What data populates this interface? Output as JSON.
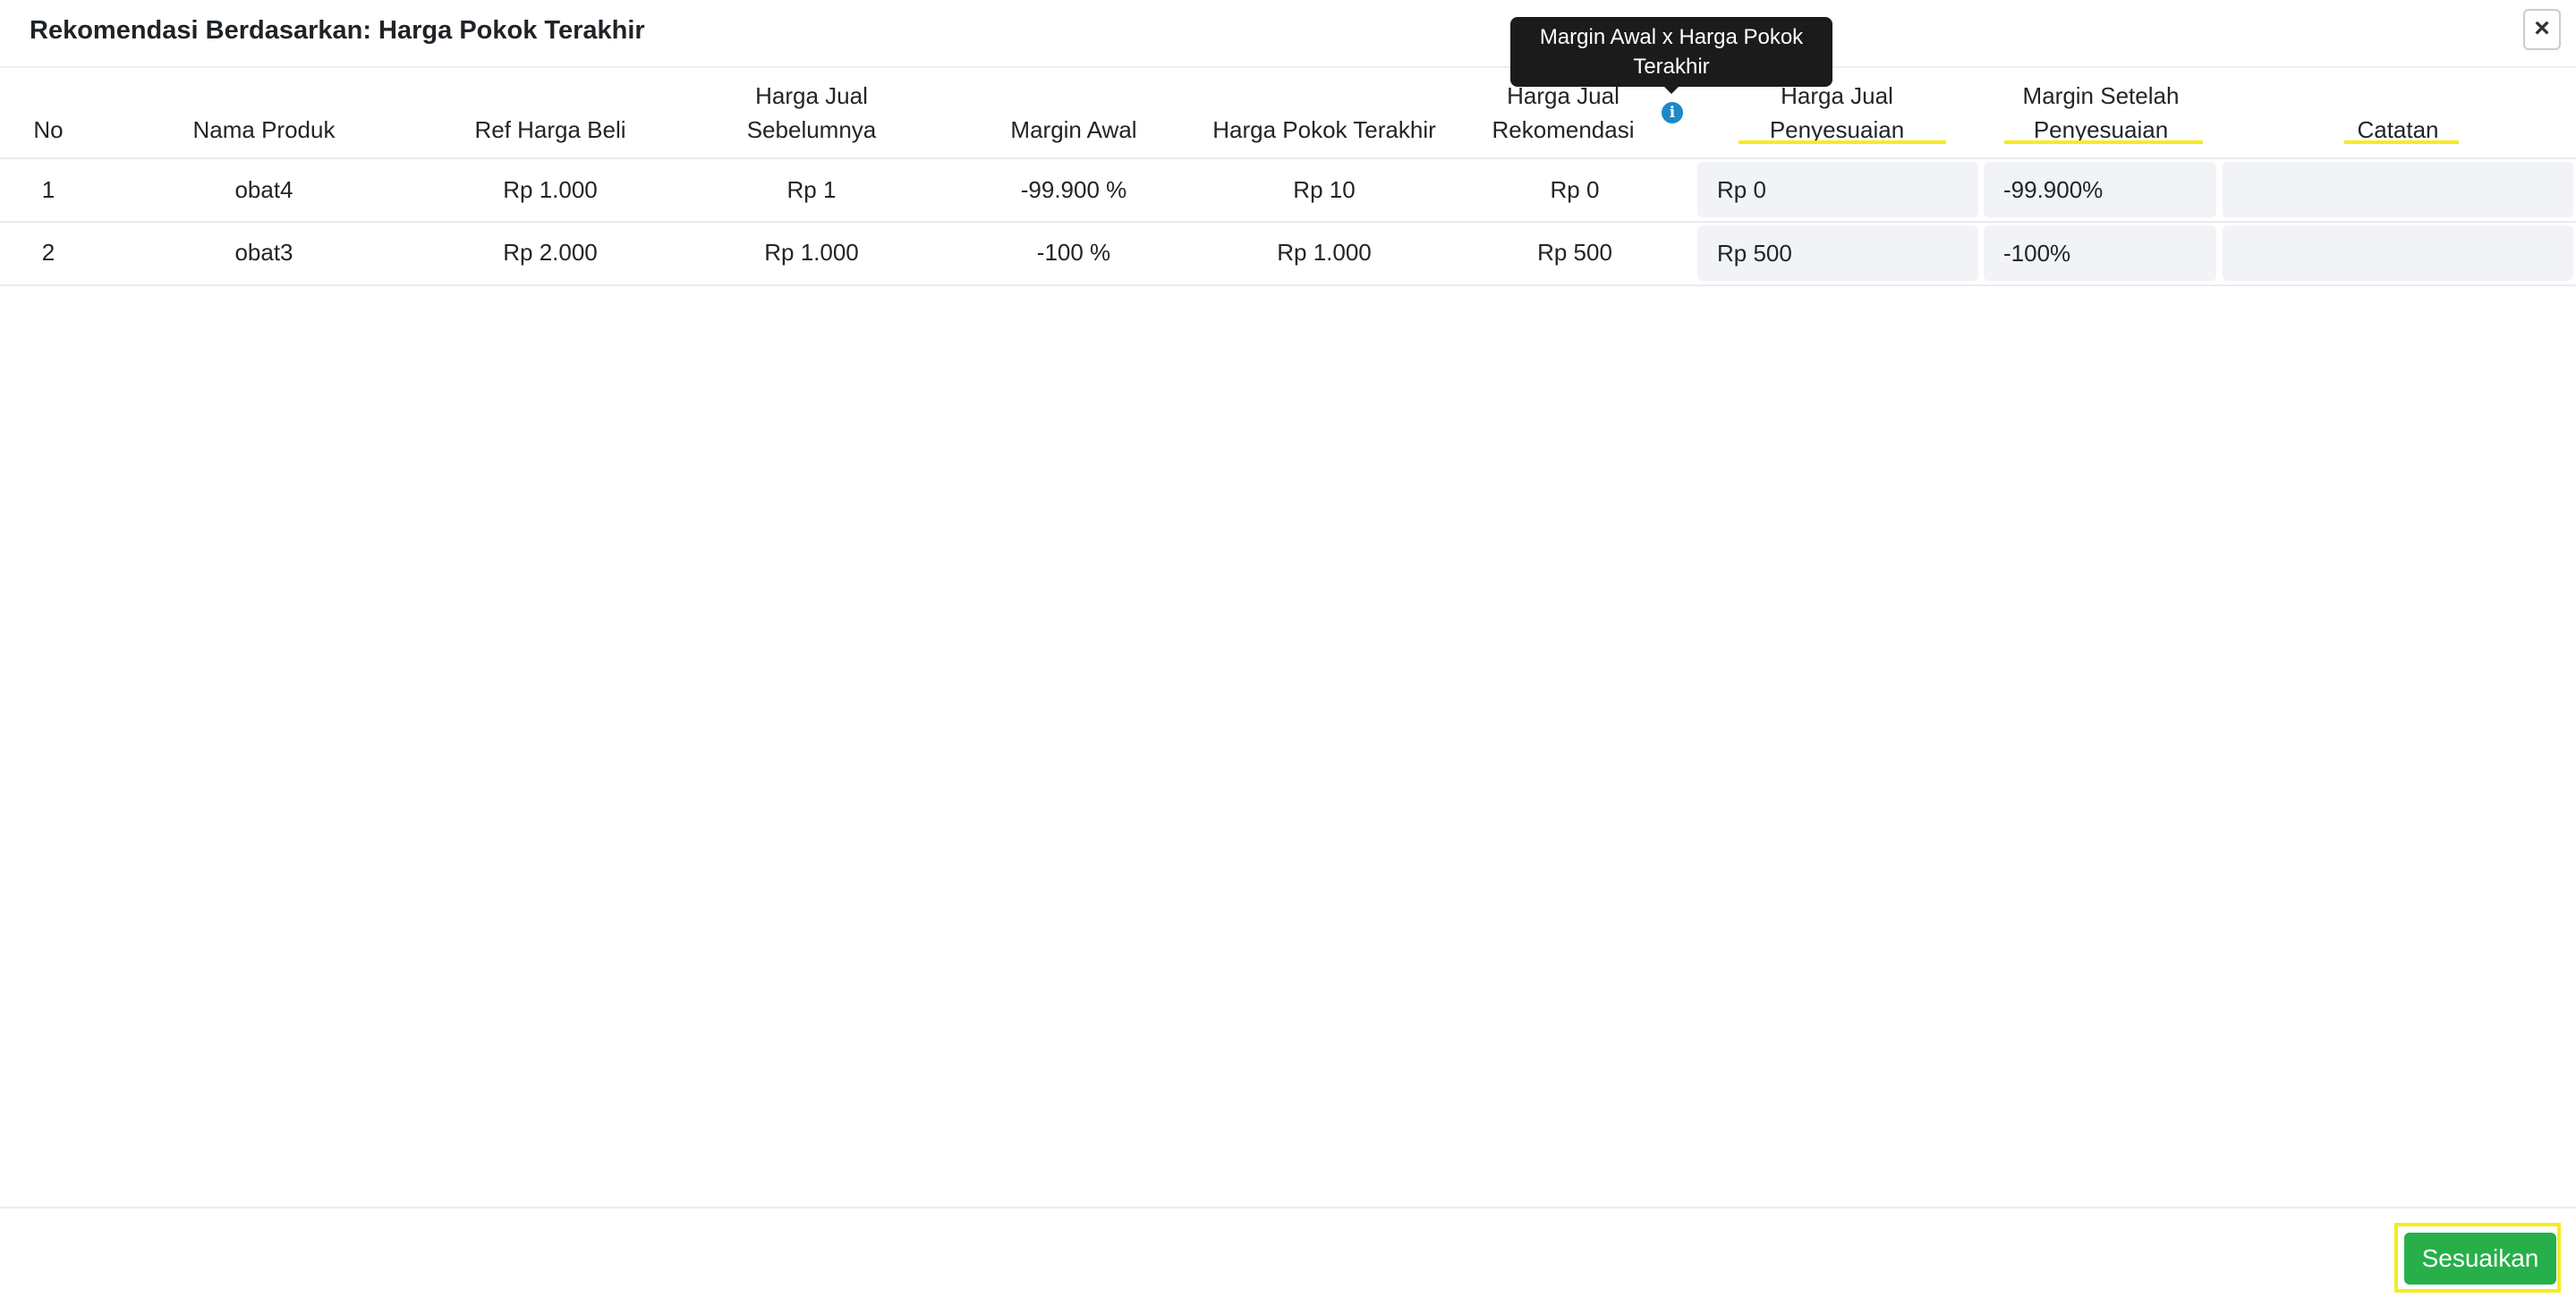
{
  "modal": {
    "title": "Rekomendasi Berdasarkan: Harga Pokok Terakhir",
    "close_symbol": "×"
  },
  "tooltip": {
    "line1": "Margin Awal x Harga Pokok",
    "line2": "Terakhir"
  },
  "table": {
    "headers": {
      "no": "No",
      "nama_produk": "Nama Produk",
      "ref_harga_beli": "Ref Harga Beli",
      "harga_jual_sebelumnya_1": "Harga Jual",
      "harga_jual_sebelumnya_2": "Sebelumnya",
      "margin_awal": "Margin Awal",
      "harga_pokok_terakhir": "Harga Pokok Terakhir",
      "harga_jual_rekomendasi_1": "Harga Jual",
      "harga_jual_rekomendasi_2": "Rekomendasi",
      "harga_jual_penyesuaian_1": "Harga Jual",
      "harga_jual_penyesuaian_2": "Penyesuaian",
      "margin_setelah_1": "Margin Setelah",
      "margin_setelah_2": "Penyesuaian",
      "catatan": "Catatan"
    },
    "rows": [
      {
        "no": "1",
        "nama_produk": "obat4",
        "ref_harga_beli": "Rp 1.000",
        "harga_jual_sebelumnya": "Rp 1",
        "margin_awal": "-99.900 %",
        "harga_pokok_terakhir": "Rp 10",
        "harga_jual_rekomendasi": "Rp 0",
        "harga_jual_penyesuaian": "Rp 0",
        "margin_setelah_penyesuaian": "-99.900%",
        "catatan": ""
      },
      {
        "no": "2",
        "nama_produk": "obat3",
        "ref_harga_beli": "Rp 2.000",
        "harga_jual_sebelumnya": "Rp 1.000",
        "margin_awal": "-100 %",
        "harga_pokok_terakhir": "Rp 1.000",
        "harga_jual_rekomendasi": "Rp 500",
        "harga_jual_penyesuaian": "Rp 500",
        "margin_setelah_penyesuaian": "-100%",
        "catatan": ""
      }
    ]
  },
  "footer": {
    "save_label": "Sesuaikan"
  },
  "colors": {
    "accent_green": "#27b04a",
    "highlight_yellow": "#f7ec1d",
    "info_blue": "#1e88c8"
  },
  "icons": {
    "close": "close-icon",
    "info": "info-icon"
  }
}
